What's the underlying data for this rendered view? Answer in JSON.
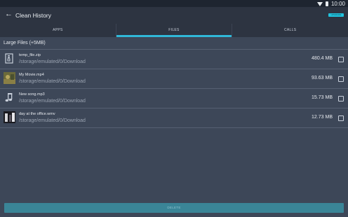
{
  "status": {
    "time": "10:00"
  },
  "appbar": {
    "title": "Clean History",
    "badge": "UPGRADE"
  },
  "tabs": [
    {
      "label": "APPS",
      "active": false
    },
    {
      "label": "FILES",
      "active": true
    },
    {
      "label": "CALLS",
      "active": false
    }
  ],
  "section": {
    "label": "Large Files (+5MB)"
  },
  "files": [
    {
      "name": "temp_file.zip",
      "path": "/storage/emulated/0/Download",
      "size": "480.4 MB",
      "icon": "zip-file-icon",
      "checked": false
    },
    {
      "name": "My Movie.mp4",
      "path": "/storage/emulated/0/Download",
      "size": "93.63 MB",
      "icon": "video-thumbnail",
      "checked": false
    },
    {
      "name": "New song.mp3",
      "path": "/storage/emulated/0/Download",
      "size": "15.73 MB",
      "icon": "music-note-icon",
      "checked": false
    },
    {
      "name": "day at the office.wmv",
      "path": "/storage/emulated/0/Download",
      "size": "12.73 MB",
      "icon": "video-thumbnail",
      "checked": false
    }
  ],
  "footer": {
    "delete_label": "DELETE"
  },
  "colors": {
    "accent": "#30b8d8",
    "button": "#3a8597",
    "background": "#3d4758",
    "appbar": "#2d3441"
  }
}
